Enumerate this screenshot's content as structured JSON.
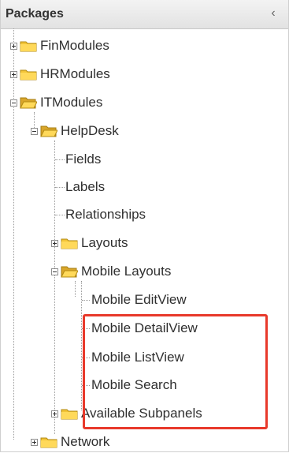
{
  "panel": {
    "title": "Packages",
    "collapse_glyph": "‹"
  },
  "tree": {
    "finmodules": "FinModules",
    "hrmodules": "HRModules",
    "itmodules": "ITModules",
    "helpdesk": "HelpDesk",
    "fields": "Fields",
    "labels": "Labels",
    "relationships": "Relationships",
    "layouts": "Layouts",
    "mobile_layouts": "Mobile Layouts",
    "mobile_editview": "Mobile EditView",
    "mobile_detailview": "Mobile DetailView",
    "mobile_listview": "Mobile ListView",
    "mobile_search": "Mobile Search",
    "available_subpanels": "Available Subpanels",
    "network": "Network"
  },
  "icons": {
    "folder": "folder-icon",
    "folder_open": "folder-open-icon",
    "expand": "plus-icon",
    "collapse": "minus-icon"
  },
  "colors": {
    "highlight": "#e8392b",
    "folder": "#f2c437"
  }
}
